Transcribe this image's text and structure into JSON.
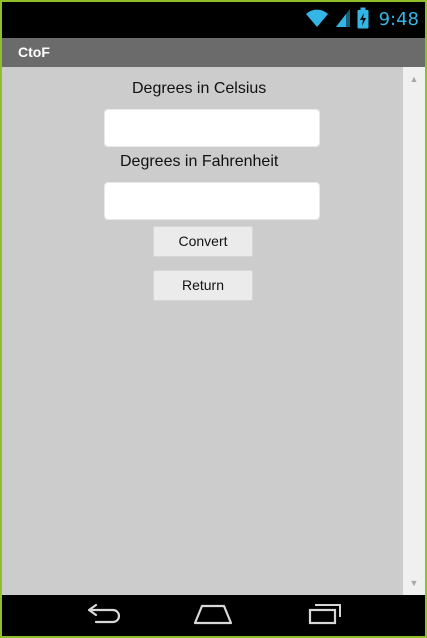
{
  "status_bar": {
    "time": "9:48",
    "icons": [
      "wifi-icon",
      "cell-signal-icon",
      "battery-charging-icon"
    ],
    "accent_color": "#33b5e5"
  },
  "title_bar": {
    "title": "CtoF"
  },
  "form": {
    "celsius_label": "Degrees in Celsius",
    "celsius_value": "",
    "fahrenheit_label": "Degrees in Fahrenheit",
    "fahrenheit_value": "",
    "convert_label": "Convert",
    "return_label": "Return"
  },
  "scrollbar": {
    "icons": [
      "scroll-up-arrow-icon",
      "scroll-down-arrow-icon"
    ]
  },
  "nav_bar": {
    "icons": [
      "back-icon",
      "home-icon",
      "recent-apps-icon"
    ]
  },
  "colors": {
    "frame_border": "#8fbf2a",
    "title_bar": "#6b6b6b",
    "background": "#cccccc"
  }
}
